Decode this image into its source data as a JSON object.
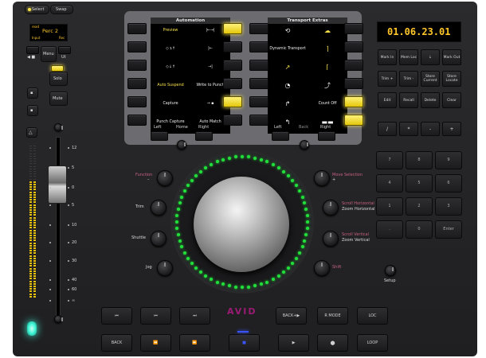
{
  "top_left": {
    "select": "Select",
    "swap": "Swap"
  },
  "channel_display": {
    "line1": "read",
    "name": "Perc 2",
    "input": "Input",
    "rec": "Rec",
    "menu": "Menu",
    "left_marker": "◀ ■",
    "right_marker": "Ut"
  },
  "channel_buttons": {
    "solo": "Solo",
    "mute": "Mute"
  },
  "fader_scale": [
    "12",
    "5",
    "0",
    "5",
    "10",
    "20",
    "30",
    "40",
    "60",
    "∞"
  ],
  "automation": {
    "title": "Automation",
    "cells": [
      "Preview",
      "|←→|",
      "◇↴↑",
      "|←",
      "◇↓↑",
      "→|",
      "Auto Suspend",
      "Write to Punch",
      "Capture",
      "→ ▪",
      "Punch Capture",
      "Auto Match"
    ],
    "bottom_left": "Left",
    "bottom_home": "Home",
    "bottom_right": "Right"
  },
  "transport_extras": {
    "title": "Transport Extras",
    "cells": [
      "⟲",
      "☁",
      "Dynamic Transport",
      "⌉",
      "↗",
      "⌈",
      "◔",
      "⤴",
      "↱",
      "Count Off",
      "↰",
      "▬▬"
    ],
    "bottom_left": "Left",
    "bottom_back": "Back",
    "bottom_right": "Right"
  },
  "counter": "01.06.23.01",
  "mem_keys": [
    "Mark In",
    "Mem Loc",
    "↓",
    "Mark Out",
    "Trim +",
    "Trim -",
    "Store Current",
    "Store Locate",
    "Edit",
    "Recall",
    "Delete",
    "Clear"
  ],
  "ops_keys": [
    "/",
    "*",
    "-",
    "+"
  ],
  "numpad": [
    "7",
    "8",
    "9",
    "4",
    "5",
    "6",
    "1",
    "2",
    "3",
    ".",
    "0",
    "Enter"
  ],
  "knob_labels": {
    "function": "Function",
    "trim": "Trim",
    "shuttle": "Shuttle",
    "jog": "Jog",
    "move_selection": "Move Selection",
    "scroll_horizontal": "Scroll Horizontal",
    "zoom_horizontal": "Zoom Horizontal",
    "scroll_vertical": "Scroll Vertical",
    "zoom_vertical": "Zoom Vertical",
    "shift": "Shift",
    "setup": "Setup"
  },
  "logo": "AVID",
  "transport": {
    "row1": [
      "⏮",
      "⏮",
      "⏭",
      "BACK+▶",
      "R MODE",
      "LOC"
    ],
    "row2": [
      "BACK",
      "⏪",
      "⏩",
      "■",
      "▶",
      "●",
      "LOOP"
    ]
  },
  "colors": {
    "accent_yellow": "#f5e04a",
    "counter_amber": "#ffc72a",
    "ring_green": "#22e03a",
    "status_cyan": "#3ff5d5"
  }
}
